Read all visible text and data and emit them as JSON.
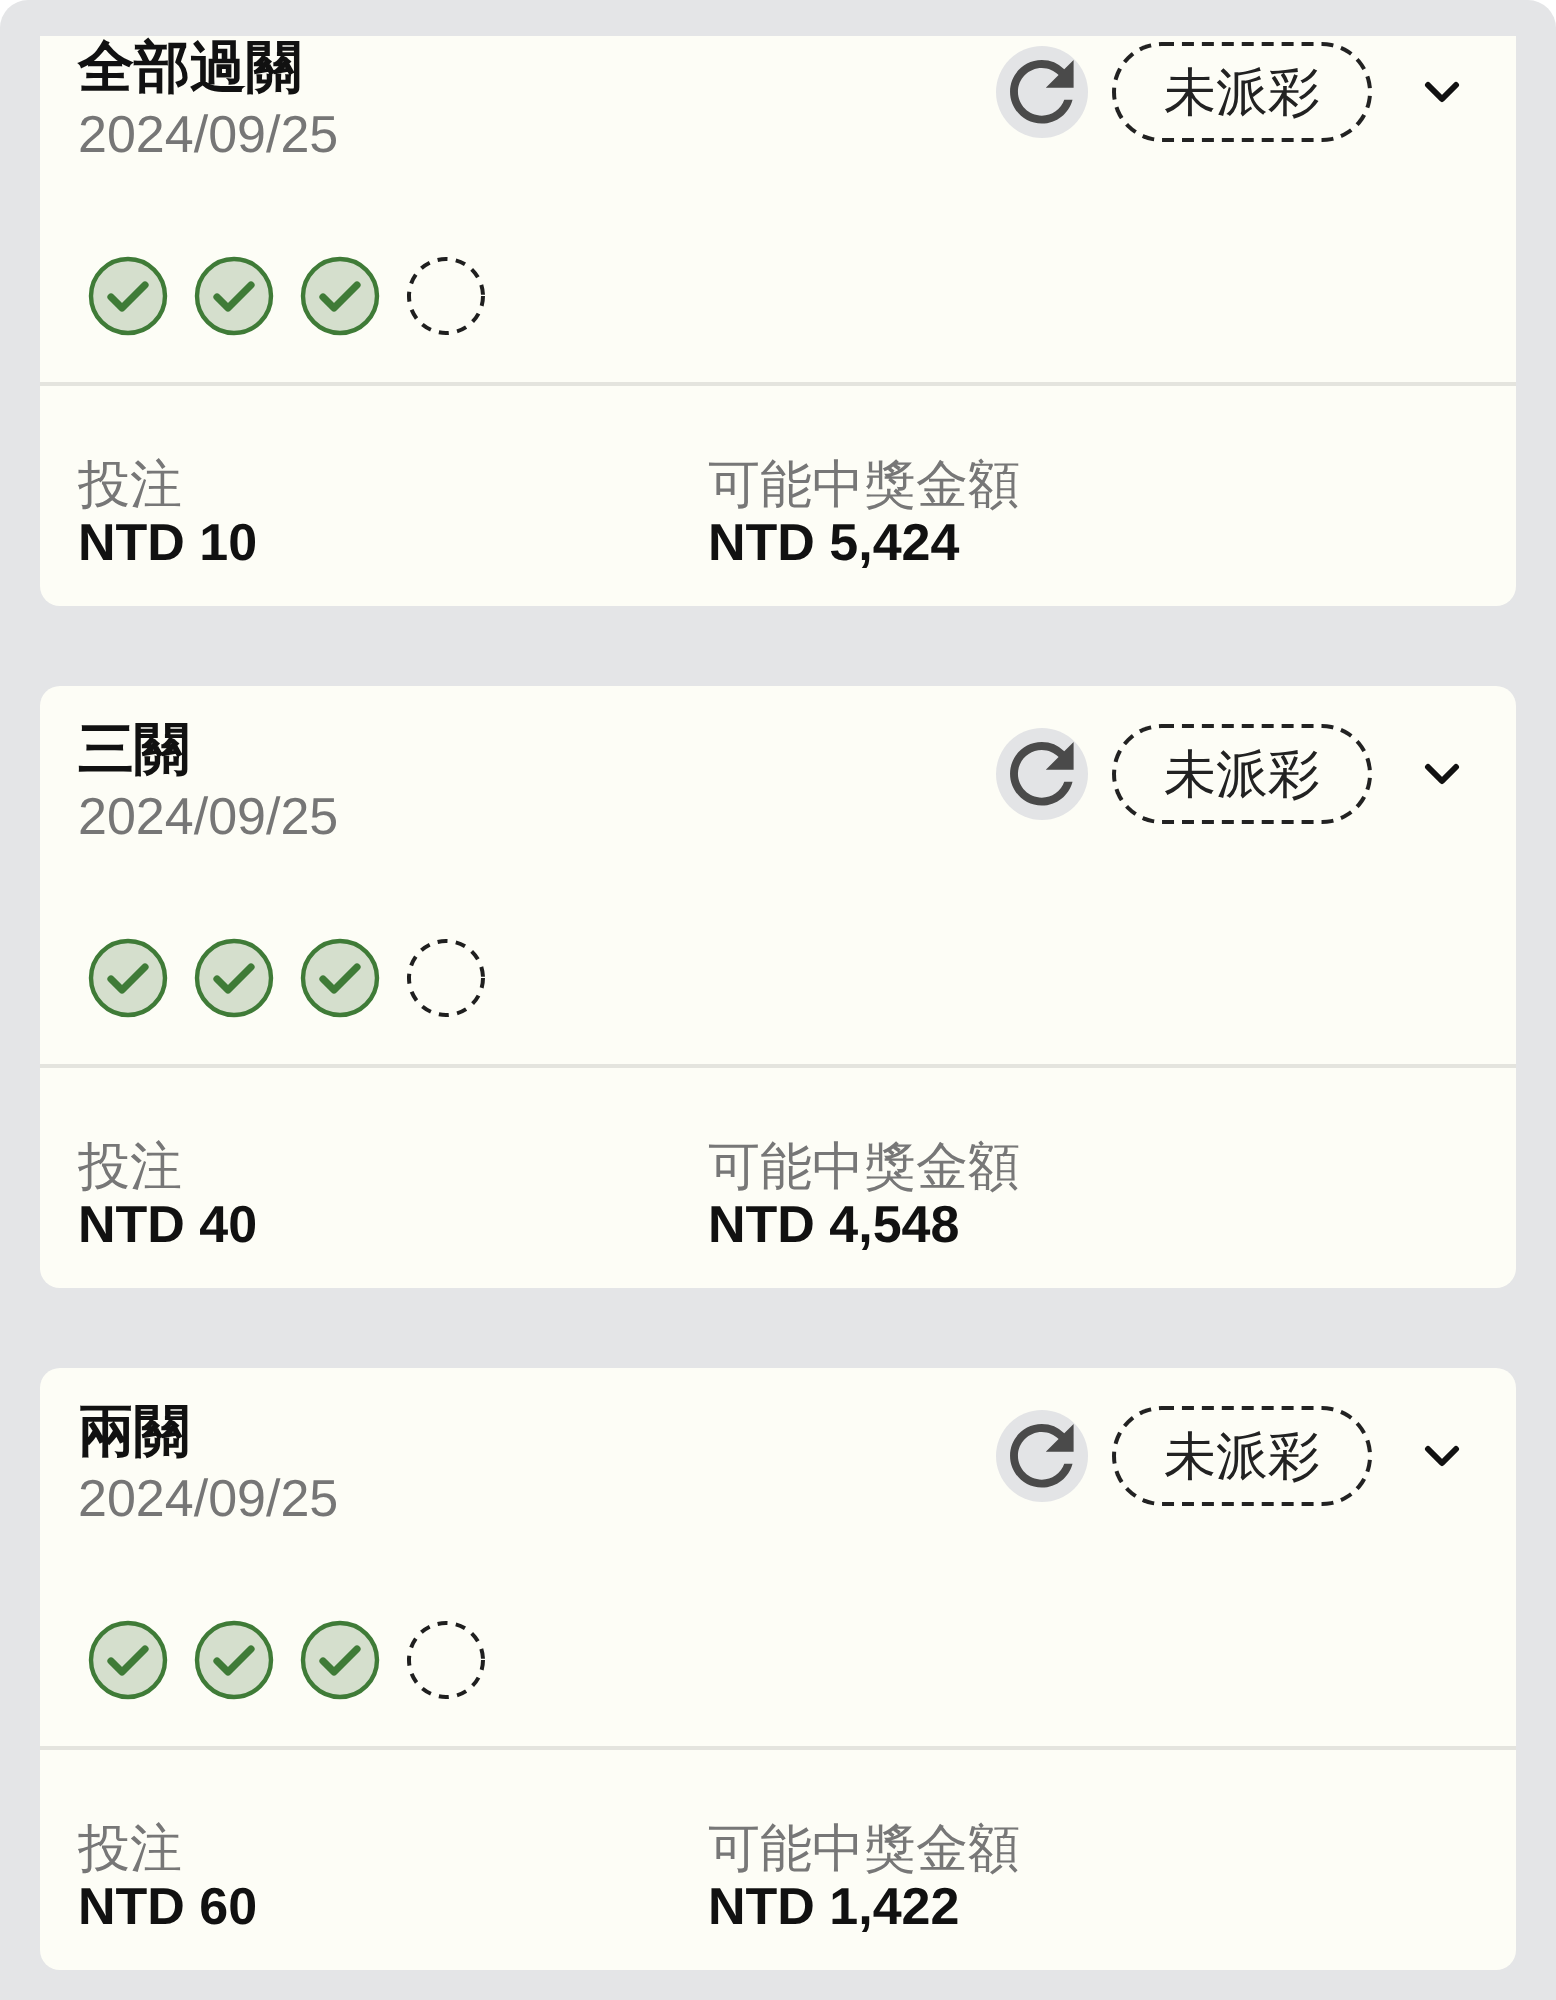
{
  "cards": [
    {
      "title": "全部過關",
      "date": "2024/09/25",
      "status_badge": "未派彩",
      "expanded": false,
      "legs": [
        {
          "kind": "won"
        },
        {
          "kind": "won"
        },
        {
          "kind": "won"
        },
        {
          "kind": "pending"
        }
      ],
      "stake": {
        "label": "投注",
        "value": "NTD 10"
      },
      "payout": {
        "label": "可能中獎金額",
        "value": "NTD 5,424"
      }
    },
    {
      "title": "三關",
      "date": "2024/09/25",
      "status_badge": "未派彩",
      "expanded": false,
      "legs": [
        {
          "kind": "won"
        },
        {
          "kind": "won"
        },
        {
          "kind": "won"
        },
        {
          "kind": "pending"
        }
      ],
      "stake": {
        "label": "投注",
        "value": "NTD 40"
      },
      "payout": {
        "label": "可能中獎金額",
        "value": "NTD 4,548"
      }
    },
    {
      "title": "兩關",
      "date": "2024/09/25",
      "status_badge": "未派彩",
      "expanded": false,
      "legs": [
        {
          "kind": "won"
        },
        {
          "kind": "won"
        },
        {
          "kind": "won"
        },
        {
          "kind": "pending"
        }
      ],
      "stake": {
        "label": "投注",
        "value": "NTD 60"
      },
      "payout": {
        "label": "可能中獎金額",
        "value": "NTD 1,422"
      }
    }
  ]
}
